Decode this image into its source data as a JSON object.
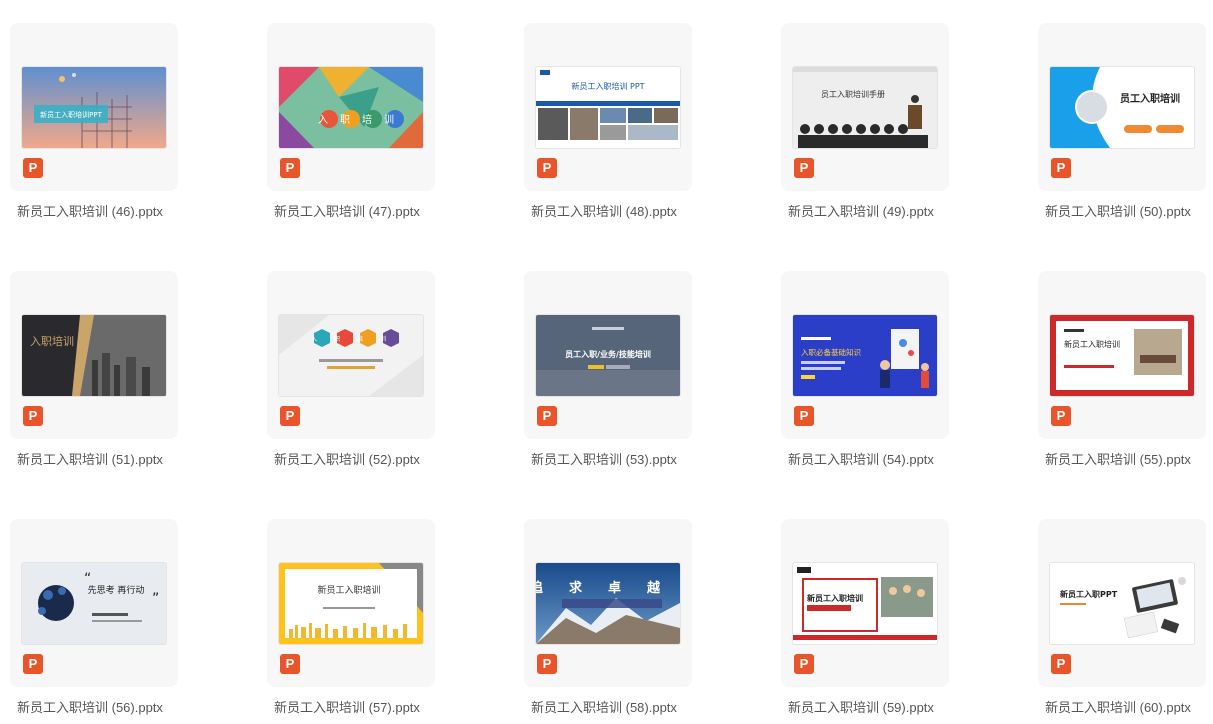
{
  "badge_letter": "P",
  "files": [
    {
      "name": "新员工入职培训 (46).pptx",
      "slide_text": "新员工入职培训PPT"
    },
    {
      "name": "新员工入职培训 (47).pptx",
      "slide_text": "入职培训"
    },
    {
      "name": "新员工入职培训 (48).pptx",
      "slide_text": "新员工入职培训 PPT"
    },
    {
      "name": "新员工入职培训 (49).pptx",
      "slide_text": "员工入职培训手册"
    },
    {
      "name": "新员工入职培训 (50).pptx",
      "slide_text": "员工入职培训"
    },
    {
      "name": "新员工入职培训 (51).pptx",
      "slide_text": "入职培训"
    },
    {
      "name": "新员工入职培训 (52).pptx",
      "slide_text": "入职培训"
    },
    {
      "name": "新员工入职培训 (53).pptx",
      "slide_text": "员工入职/业务/技能培训"
    },
    {
      "name": "新员工入职培训 (54).pptx",
      "slide_text": "入职必备基础知识"
    },
    {
      "name": "新员工入职培训 (55).pptx",
      "slide_text": "新员工入职培训"
    },
    {
      "name": "新员工入职培训 (56).pptx",
      "slide_text": "先思考 再行动"
    },
    {
      "name": "新员工入职培训 (57).pptx",
      "slide_text": "新员工入职培训"
    },
    {
      "name": "新员工入职培训 (58).pptx",
      "slide_text": "追求卓越"
    },
    {
      "name": "新员工入职培训 (59).pptx",
      "slide_text": "新员工入职培训"
    },
    {
      "name": "新员工入职培训 (60).pptx",
      "slide_text": "新员工入职PPT"
    }
  ]
}
